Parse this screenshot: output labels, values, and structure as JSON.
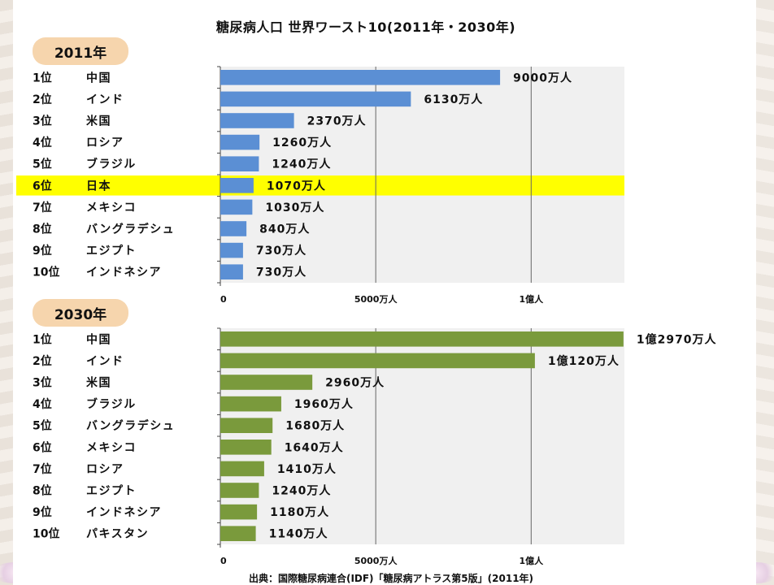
{
  "title": "糖尿病人口 世界ワースト10(2011年・2030年)",
  "source": "出典：国際糖尿病連合(IDF)「糖尿病アトラス第5版」(2011年)",
  "colors": {
    "bar_2011": "#5b8fd4",
    "bar_2030": "#7a9a3c",
    "highlight": "#ffff00",
    "plot_bg": "#f0f0f0",
    "badge": "#f6d5ad"
  },
  "chart_data": [
    {
      "type": "bar",
      "orientation": "horizontal",
      "badge": "2011年",
      "ranks": [
        "1位",
        "2位",
        "3位",
        "4位",
        "5位",
        "6位",
        "7位",
        "8位",
        "9位",
        "10位"
      ],
      "categories": [
        "中国",
        "インド",
        "米国",
        "ロシア",
        "ブラジル",
        "日本",
        "メキシコ",
        "バングラデシュ",
        "エジプト",
        "インドネシア"
      ],
      "values": [
        9000,
        6130,
        2370,
        1260,
        1240,
        1070,
        1030,
        840,
        730,
        730
      ],
      "value_labels": [
        "9000万人",
        "6130万人",
        "2370万人",
        "1260万人",
        "1240万人",
        "1070万人",
        "1030万人",
        "840万人",
        "730万人",
        "730万人"
      ],
      "highlight_index": 5,
      "unit": "万人",
      "xlim": [
        0,
        13000
      ],
      "xticks": [
        0,
        5000,
        10000
      ],
      "xtick_labels": [
        "0",
        "5000万人",
        "1億人"
      ],
      "grid": true
    },
    {
      "type": "bar",
      "orientation": "horizontal",
      "badge": "2030年",
      "ranks": [
        "1位",
        "2位",
        "3位",
        "4位",
        "5位",
        "6位",
        "7位",
        "8位",
        "9位",
        "10位"
      ],
      "categories": [
        "中国",
        "インド",
        "米国",
        "ブラジル",
        "バングラデシュ",
        "メキシコ",
        "ロシア",
        "エジプト",
        "インドネシア",
        "パキスタン"
      ],
      "values": [
        12970,
        10120,
        2960,
        1960,
        1680,
        1640,
        1410,
        1240,
        1180,
        1140
      ],
      "value_labels": [
        "1億2970万人",
        "1億120万人",
        "2960万人",
        "1960万人",
        "1680万人",
        "1640万人",
        "1410万人",
        "1240万人",
        "1180万人",
        "1140万人"
      ],
      "highlight_index": null,
      "unit": "万人",
      "xlim": [
        0,
        13000
      ],
      "xticks": [
        0,
        5000,
        10000
      ],
      "xtick_labels": [
        "0",
        "5000万人",
        "1億人"
      ],
      "grid": true
    }
  ]
}
